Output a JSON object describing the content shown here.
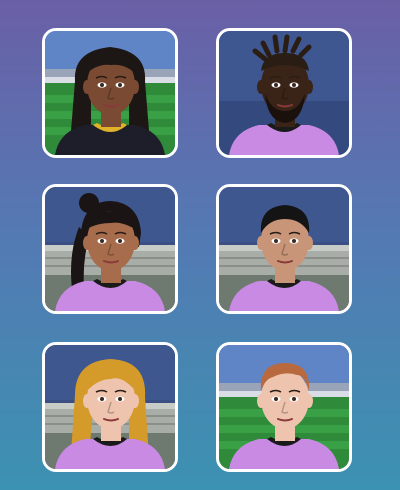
{
  "avatars": [
    {
      "name": "avatar-1",
      "skin": "#7a4a32",
      "hair": "#1c1614",
      "hair_style": "long-curly",
      "shirt": "#1e1e2a",
      "trim": "#e0b22a",
      "background": "stadium"
    },
    {
      "name": "avatar-2",
      "skin": "#3a2418",
      "hair": "#2a1e14",
      "hair_style": "twists",
      "shirt": "#c98ae4",
      "trim": "#1a1a1a",
      "background": "indoor"
    },
    {
      "name": "avatar-3",
      "skin": "#a66c4b",
      "hair": "#1a1414",
      "hair_style": "braid-bun",
      "shirt": "#c98ae4",
      "trim": "#1a1a1a",
      "background": "bleachers"
    },
    {
      "name": "avatar-4",
      "skin": "#c89578",
      "hair": "#141414",
      "hair_style": "short",
      "shirt": "#c98ae4",
      "trim": "#1a1a1a",
      "background": "bleachers"
    },
    {
      "name": "avatar-5",
      "skin": "#efc4ae",
      "hair": "#d49a2a",
      "hair_style": "long-wavy",
      "shirt": "#c98ae4",
      "trim": "#1a1a1a",
      "background": "bleachers"
    },
    {
      "name": "avatar-6",
      "skin": "#efc4ae",
      "hair": "#b86a3e",
      "hair_style": "short-wavy",
      "shirt": "#c98ae4",
      "trim": "#1a1a1a",
      "background": "stadium"
    }
  ],
  "colors": {
    "card_border": "#ffffff",
    "background_top": "#6a5fa6",
    "background_bottom": "#3c92b2"
  }
}
